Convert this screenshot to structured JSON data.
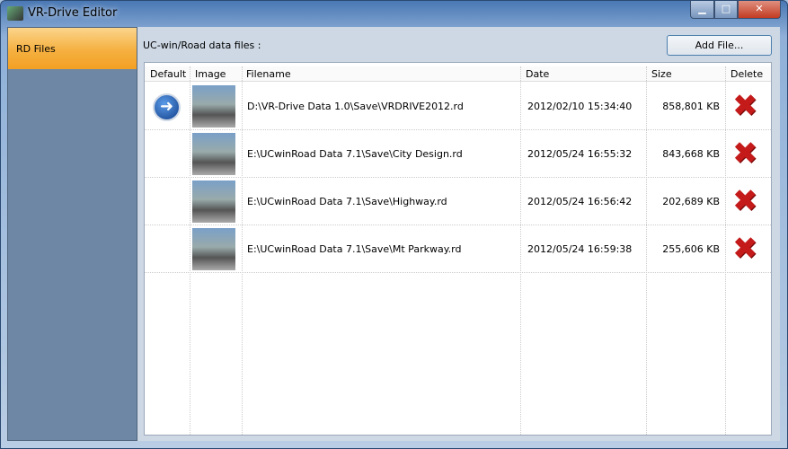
{
  "window": {
    "title": "VR-Drive Editor",
    "minimize": "▁",
    "maximize": "□",
    "close": "✕"
  },
  "sidebar": {
    "items": [
      {
        "label": "RD Files"
      }
    ]
  },
  "main": {
    "label": "UC-win/Road data files :",
    "add_button": "Add File..."
  },
  "table": {
    "columns": [
      "Default",
      "Image",
      "Filename",
      "Date",
      "Size",
      "Delete"
    ],
    "rows": [
      {
        "default": true,
        "filename": "D:\\VR-Drive Data 1.0\\Save\\VRDRIVE2012.rd",
        "date": "2012/02/10 15:34:40",
        "size": "858,801 KB"
      },
      {
        "default": false,
        "filename": "E:\\UCwinRoad Data 7.1\\Save\\City Design.rd",
        "date": "2012/05/24 16:55:32",
        "size": "843,668 KB"
      },
      {
        "default": false,
        "filename": "E:\\UCwinRoad Data 7.1\\Save\\Highway.rd",
        "date": "2012/05/24 16:56:42",
        "size": "202,689 KB"
      },
      {
        "default": false,
        "filename": "E:\\UCwinRoad Data 7.1\\Save\\Mt Parkway.rd",
        "date": "2012/05/24 16:59:38",
        "size": "255,606 KB"
      }
    ]
  },
  "icons": {
    "default": "arrow-right-icon",
    "delete": "red-x-icon"
  }
}
